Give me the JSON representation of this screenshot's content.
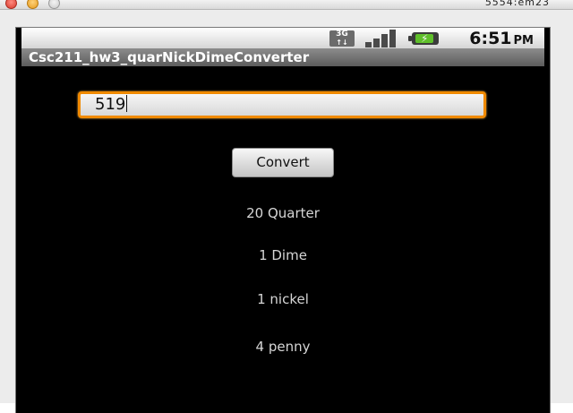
{
  "window": {
    "title": "5554:em23"
  },
  "status_bar": {
    "network_type": "3G",
    "network_sub": "↑↓",
    "signal_bars": 4,
    "battery_level": 0.9,
    "time": "6:51",
    "ampm": "PM"
  },
  "app": {
    "title": "Csc211_hw3_quarNickDimeConverter",
    "input_value": "519",
    "convert_label": "Convert",
    "results": {
      "quarter": "20 Quarter",
      "dime": "1 Dime",
      "nickel": "1 nickel",
      "penny": "4 penny"
    }
  }
}
